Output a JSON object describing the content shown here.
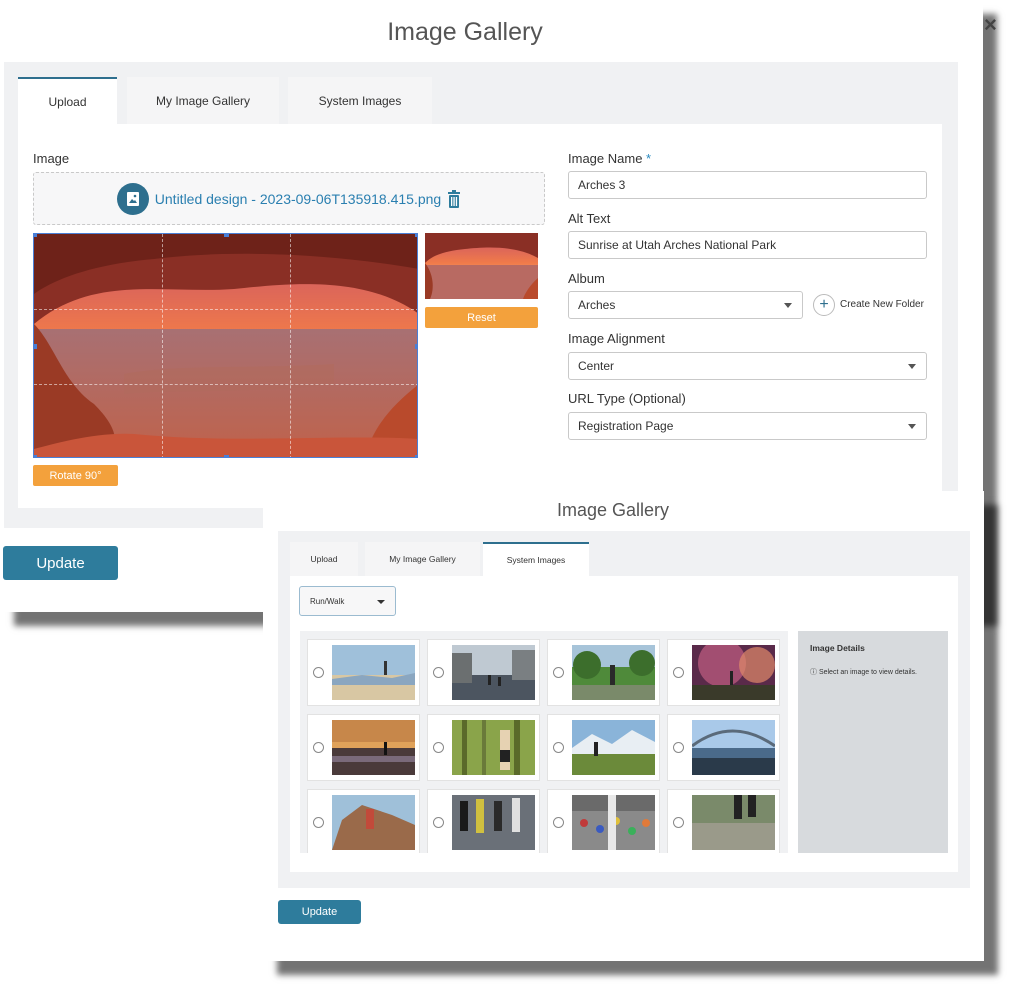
{
  "back_modal": {
    "title": "Image Gallery",
    "close": "×",
    "tabs": [
      {
        "label": "Upload",
        "active": true
      },
      {
        "label": "My Image Gallery",
        "active": false
      },
      {
        "label": "System Images",
        "active": false
      }
    ],
    "image_label": "Image",
    "file_name": "Untitled design - 2023-09-06T135918.415.png",
    "reset_label": "Reset",
    "rotate_label": "Rotate 90°",
    "fields": {
      "image_name_label": "Image Name",
      "required_mark": "*",
      "image_name_value": "Arches 3",
      "alt_text_label": "Alt Text",
      "alt_text_value": "Sunrise at Utah Arches National Park",
      "album_label": "Album",
      "album_value": "Arches",
      "create_folder_label": "Create New Folder",
      "alignment_label": "Image Alignment",
      "alignment_value": "Center",
      "url_type_label": "URL Type (Optional)",
      "url_type_value": "Registration Page"
    },
    "update_label": "Update"
  },
  "front_modal": {
    "title": "Image Gallery",
    "tabs": [
      {
        "label": "Upload",
        "active": false
      },
      {
        "label": "My Image Gallery",
        "active": false
      },
      {
        "label": "System Images",
        "active": true
      }
    ],
    "category_value": "Run/Walk",
    "details_title": "Image Details",
    "details_hint": "ⓘ Select an image to view details.",
    "update_label": "Update"
  },
  "colors": {
    "accent_teal": "#2e7c9c",
    "accent_orange": "#f3a13c",
    "link_blue": "#2a7fb0"
  }
}
